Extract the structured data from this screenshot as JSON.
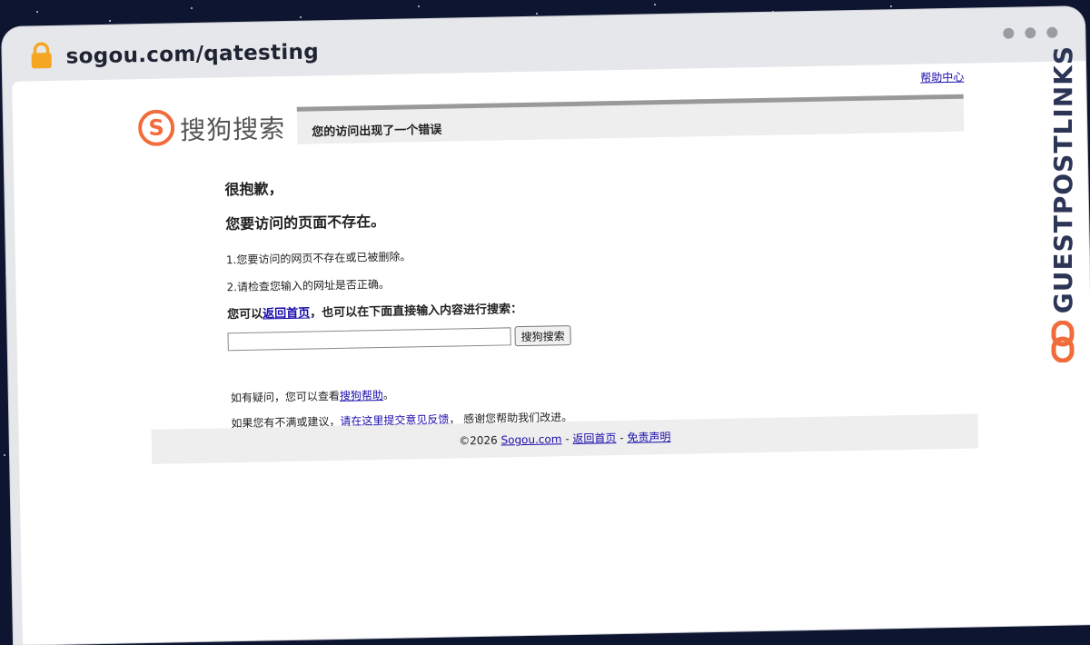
{
  "browser": {
    "url": "sogou.com/qatesting",
    "lock_icon": "lock-icon",
    "window_dots": [
      "dot",
      "dot",
      "dot"
    ]
  },
  "page": {
    "help_link": "帮助中心",
    "logo_text": "搜狗搜索",
    "header_message": "您的访问出现了一个错误",
    "sorry": "很抱歉，",
    "not_exist": "您要访问的页面不存在。",
    "reason1": "1.您要访问的网页不存在或已被删除。",
    "reason2": "2.请检查您输入的网址是否正确。",
    "prompt_prefix": "您可以",
    "prompt_link": "返回首页",
    "prompt_suffix": "，也可以在下面直接输入内容进行搜索：",
    "search_value": "",
    "search_button": "搜狗搜索",
    "question_prefix": "如有疑问，您可以查看",
    "question_link": "搜狗帮助",
    "question_suffix": "。",
    "feedback_prefix": "如果您有不满或建议，",
    "feedback_link": "请在这里提交意见反馈",
    "feedback_suffix": "， 感谢您帮助我们改进。",
    "footer_copyright": "©2026 ",
    "footer_link1": "Sogou.com",
    "footer_sep1": " - ",
    "footer_link2": "返回首页",
    "footer_sep2": " - ",
    "footer_link3": "免责声明"
  },
  "brand": {
    "text": "GUESTPOSTLINKS",
    "icon": "chain-link-icon",
    "accent": "#f26b3a"
  },
  "colors": {
    "link": "#1a0dab",
    "logo_accent": "#f26b3a",
    "background": "#0d1530"
  }
}
